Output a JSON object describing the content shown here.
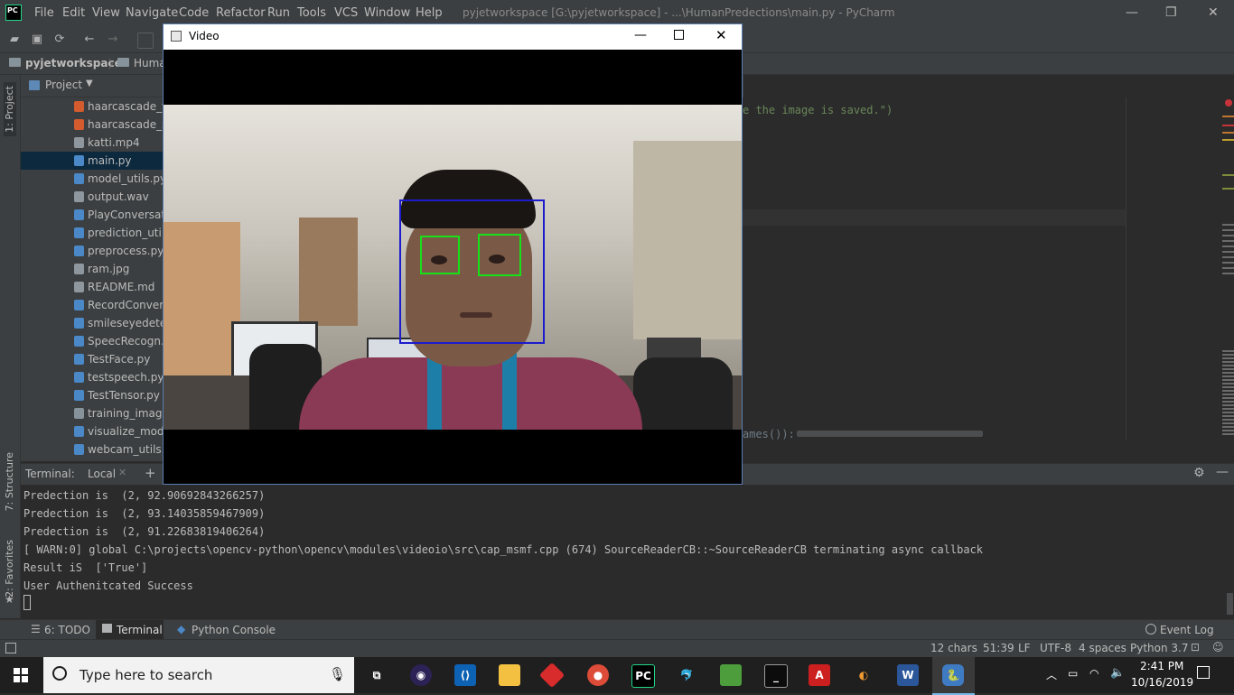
{
  "menubar": {
    "logo": "PC",
    "items": [
      "File",
      "Edit",
      "View",
      "Navigate",
      "Code",
      "Refactor",
      "Run",
      "Tools",
      "VCS",
      "Window",
      "Help"
    ],
    "title": "pyjetworkspace [G:\\pyjetworkspace] - ...\\HumanPredections\\main.py - PyCharm"
  },
  "breadcrumb": {
    "root": "pyjetworkspace",
    "child": "Huma"
  },
  "project": {
    "header": "Project",
    "files": [
      {
        "name": "haarcascade_fro",
        "icon": "xml-icon"
      },
      {
        "name": "haarcascade_sn",
        "icon": "xml-icon"
      },
      {
        "name": "katti.mp4",
        "icon": "file-icon"
      },
      {
        "name": "main.py",
        "icon": "python-file-icon"
      },
      {
        "name": "model_utils.py",
        "icon": "python-file-icon"
      },
      {
        "name": "output.wav",
        "icon": "file-icon"
      },
      {
        "name": "PlayConversatio",
        "icon": "python-file-icon"
      },
      {
        "name": "prediction_utils",
        "icon": "python-file-icon"
      },
      {
        "name": "preprocess.py",
        "icon": "python-file-icon"
      },
      {
        "name": "ram.jpg",
        "icon": "image-file-icon"
      },
      {
        "name": "README.md",
        "icon": "file-icon"
      },
      {
        "name": "RecordConversa",
        "icon": "python-file-icon"
      },
      {
        "name": "smileseyedetect",
        "icon": "python-file-icon"
      },
      {
        "name": "SpeecRecogn.py",
        "icon": "python-file-icon"
      },
      {
        "name": "TestFace.py",
        "icon": "python-file-icon"
      },
      {
        "name": "testspeech.py",
        "icon": "python-file-icon"
      },
      {
        "name": "TestTensor.py",
        "icon": "python-file-icon"
      },
      {
        "name": "training_images",
        "icon": "folder-icon"
      },
      {
        "name": "visualize_model",
        "icon": "python-file-icon"
      },
      {
        "name": "webcam_utils.p",
        "icon": "python-file-icon"
      }
    ]
  },
  "editor": {
    "line1": "e the image is saved.\")",
    "line2": "ames()):"
  },
  "leftstrip": {
    "project": "1: Project",
    "structure": "7: Structure",
    "favorites": "2: Favorites"
  },
  "video": {
    "title": "Video",
    "bg_color": "#c9c6bf"
  },
  "terminal": {
    "label": "Terminal:",
    "tab": "Local",
    "lines": [
      "Predection is  (2, 92.90692843266257)",
      "Predection is  (2, 93.14035859467909)",
      "Predection is  (2, 91.22683819406264)",
      "[ WARN:0] global C:\\projects\\opencv-python\\opencv\\modules\\videoio\\src\\cap_msmf.cpp (674) SourceReaderCB::~SourceReaderCB terminating async callback",
      "Result iS  ['True']",
      "User Authenitcated Success"
    ]
  },
  "tooltabs": {
    "todo": "6: TODO",
    "terminal": "Terminal",
    "console": "Python Console",
    "eventlog": "Event Log"
  },
  "statusbar": {
    "chars": "12 chars",
    "pos": "51:39",
    "lineend": "LF",
    "encoding": "UTF-8",
    "indent": "4 spaces",
    "interpreter": "Python 3.7"
  },
  "taskbar": {
    "search_placeholder": "Type here to search",
    "time": "2:41 PM",
    "date": "10/16/2019"
  },
  "colors": {
    "face_box": "#1c1ccd",
    "eye_box": "#18e018",
    "accent": "#21d789"
  }
}
